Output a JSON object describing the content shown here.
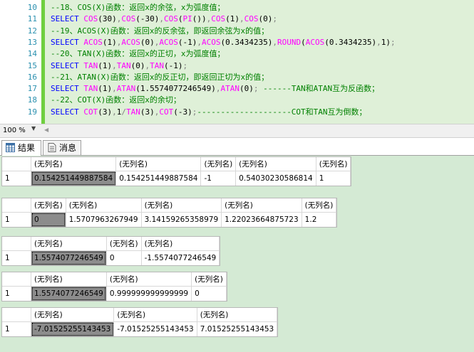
{
  "editor": {
    "lines": [
      {
        "n": "10",
        "parts": [
          {
            "t": "--18、COS(X)函数：返回x的余弦，x为弧度值；",
            "c": "comment"
          }
        ]
      },
      {
        "n": "11",
        "parts": [
          {
            "t": "SELECT ",
            "c": "kw"
          },
          {
            "t": "COS",
            "c": "fn"
          },
          {
            "t": "(30)",
            "c": "txt"
          },
          {
            "t": ",",
            "c": "op"
          },
          {
            "t": "COS",
            "c": "fn"
          },
          {
            "t": "(-30)",
            "c": "txt"
          },
          {
            "t": ",",
            "c": "op"
          },
          {
            "t": "COS",
            "c": "fn"
          },
          {
            "t": "(",
            "c": "txt"
          },
          {
            "t": "PI",
            "c": "fn"
          },
          {
            "t": "())",
            "c": "txt"
          },
          {
            "t": ",",
            "c": "op"
          },
          {
            "t": "COS",
            "c": "fn"
          },
          {
            "t": "(1)",
            "c": "txt"
          },
          {
            "t": ",",
            "c": "op"
          },
          {
            "t": "COS",
            "c": "fn"
          },
          {
            "t": "(0)",
            "c": "txt"
          },
          {
            "t": ";",
            "c": "op"
          }
        ]
      },
      {
        "n": "12",
        "parts": [
          {
            "t": "--19、ACOS(X)函数：返回x的反余弦，即返回余弦为x的值；",
            "c": "comment"
          }
        ]
      },
      {
        "n": "13",
        "parts": [
          {
            "t": "SELECT ",
            "c": "kw"
          },
          {
            "t": "ACOS",
            "c": "fn"
          },
          {
            "t": "(1)",
            "c": "txt"
          },
          {
            "t": ",",
            "c": "op"
          },
          {
            "t": "ACOS",
            "c": "fn"
          },
          {
            "t": "(0)",
            "c": "txt"
          },
          {
            "t": ",",
            "c": "op"
          },
          {
            "t": "ACOS",
            "c": "fn"
          },
          {
            "t": "(-1)",
            "c": "txt"
          },
          {
            "t": ",",
            "c": "op"
          },
          {
            "t": "ACOS",
            "c": "fn"
          },
          {
            "t": "(0.3434235)",
            "c": "txt"
          },
          {
            "t": ",",
            "c": "op"
          },
          {
            "t": "ROUND",
            "c": "fn"
          },
          {
            "t": "(",
            "c": "txt"
          },
          {
            "t": "ACOS",
            "c": "fn"
          },
          {
            "t": "(0.3434235)",
            "c": "txt"
          },
          {
            "t": ",",
            "c": "op"
          },
          {
            "t": "1)",
            "c": "txt"
          },
          {
            "t": ";",
            "c": "op"
          }
        ]
      },
      {
        "n": "14",
        "parts": [
          {
            "t": "--20、TAN(X)函数：返回x的正切，x为弧度值；",
            "c": "comment"
          }
        ]
      },
      {
        "n": "15",
        "parts": [
          {
            "t": "SELECT ",
            "c": "kw"
          },
          {
            "t": "TAN",
            "c": "fn"
          },
          {
            "t": "(1)",
            "c": "txt"
          },
          {
            "t": ",",
            "c": "op"
          },
          {
            "t": "TAN",
            "c": "fn"
          },
          {
            "t": "(0)",
            "c": "txt"
          },
          {
            "t": ",",
            "c": "op"
          },
          {
            "t": "TAN",
            "c": "fn"
          },
          {
            "t": "(-1)",
            "c": "txt"
          },
          {
            "t": ";",
            "c": "op"
          }
        ]
      },
      {
        "n": "16",
        "parts": [
          {
            "t": "--21、ATAN(X)函数：返回x的反正切，即返回正切为x的值；",
            "c": "comment"
          }
        ]
      },
      {
        "n": "17",
        "parts": [
          {
            "t": "SELECT ",
            "c": "kw"
          },
          {
            "t": "TAN",
            "c": "fn"
          },
          {
            "t": "(1)",
            "c": "txt"
          },
          {
            "t": ",",
            "c": "op"
          },
          {
            "t": "ATAN",
            "c": "fn"
          },
          {
            "t": "(1.5574077246549)",
            "c": "txt"
          },
          {
            "t": ",",
            "c": "op"
          },
          {
            "t": "ATAN",
            "c": "fn"
          },
          {
            "t": "(0)",
            "c": "txt"
          },
          {
            "t": "; ",
            "c": "op"
          },
          {
            "t": "------TAN和ATAN互为反函数；",
            "c": "comment"
          }
        ]
      },
      {
        "n": "18",
        "parts": [
          {
            "t": "--22、COT(X)函数：返回x的余切；",
            "c": "comment"
          }
        ]
      },
      {
        "n": "19",
        "parts": [
          {
            "t": "SELECT ",
            "c": "kw"
          },
          {
            "t": "COT",
            "c": "fn"
          },
          {
            "t": "(3)",
            "c": "txt"
          },
          {
            "t": ",",
            "c": "op"
          },
          {
            "t": "1",
            "c": "txt"
          },
          {
            "t": "/",
            "c": "op"
          },
          {
            "t": "TAN",
            "c": "fn"
          },
          {
            "t": "(3)",
            "c": "txt"
          },
          {
            "t": ",",
            "c": "op"
          },
          {
            "t": "COT",
            "c": "fn"
          },
          {
            "t": "(-3)",
            "c": "txt"
          },
          {
            "t": ";",
            "c": "op"
          },
          {
            "t": "--------------------COT和TAN互为倒数；",
            "c": "comment"
          }
        ]
      }
    ]
  },
  "zoom": {
    "value": "100 %"
  },
  "tabs": [
    {
      "label": "结果",
      "icon": "grid-icon",
      "active": true
    },
    {
      "label": "消息",
      "icon": "message-icon",
      "active": false
    }
  ],
  "results": {
    "grids": [
      {
        "headers": [
          "(无列名)",
          "(无列名)",
          "(无列名)",
          "(无列名)",
          "(无列名)"
        ],
        "row_number": "1",
        "cells": [
          "0.154251449887584",
          "0.154251449887584",
          "-1",
          "0.54030230586814",
          "1"
        ]
      },
      {
        "headers": [
          "(无列名)",
          "(无列名)",
          "(无列名)",
          "(无列名)",
          "(无列名)"
        ],
        "row_number": "1",
        "cells": [
          "0",
          "1.5707963267949",
          "3.14159265358979",
          "1.22023664875723",
          "1.2"
        ]
      },
      {
        "headers": [
          "(无列名)",
          "(无列名)",
          "(无列名)"
        ],
        "row_number": "1",
        "cells": [
          "1.5574077246549",
          "0",
          "-1.5574077246549"
        ]
      },
      {
        "headers": [
          "(无列名)",
          "(无列名)",
          "(无列名)"
        ],
        "row_number": "1",
        "cells": [
          "1.5574077246549",
          "0.999999999999999",
          "0"
        ]
      },
      {
        "headers": [
          "(无列名)",
          "(无列名)",
          "(无列名)"
        ],
        "row_number": "1",
        "cells": [
          "-7.01525255143453",
          "-7.01525255143453",
          "7.01525255143453"
        ]
      }
    ]
  },
  "colors": {
    "comment": "#008000",
    "keyword": "#0000ff",
    "function": "#ff00ff",
    "operator": "#808080",
    "selected_cell": "#8c8c8c",
    "results_background": "#d4ead4"
  }
}
